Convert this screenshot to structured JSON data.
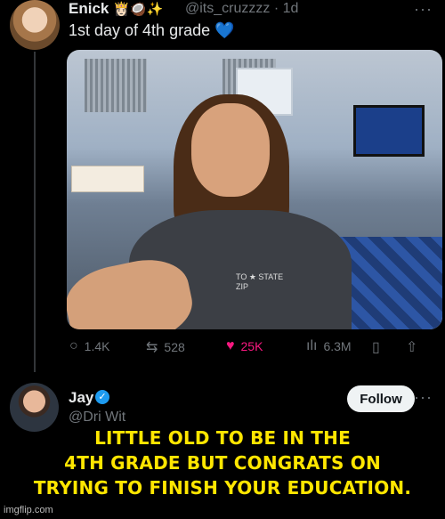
{
  "post": {
    "author_name": "Enick",
    "author_emojis": "👸🏻🥥✨",
    "handle": "@its_cruzzzz",
    "sep": "·",
    "time": "1d",
    "text": "1st day of 4th grade 💙",
    "menu": "···"
  },
  "media": {
    "shirt_text": "TO ★ STATE ZIP"
  },
  "actions": {
    "replies": "1.4K",
    "reposts": "528",
    "likes": "25K",
    "views": "6.3M",
    "icons": {
      "reply": "speech-bubble-icon",
      "repost": "repost-icon",
      "like": "heart-icon",
      "views": "bar-chart-icon",
      "bookmark": "bookmark-icon",
      "share": "share-icon"
    },
    "glyphs": {
      "reply": "○",
      "repost": "⇆",
      "like": "♥",
      "views": "ılı",
      "bookmark": "▯",
      "share": "⇧"
    }
  },
  "reply": {
    "name": "Jay",
    "handle": "@Dri Wit",
    "follow_label": "Follow",
    "menu": "···",
    "verified_glyph": "✓"
  },
  "meme_caption": "LITTLE OLD TO BE IN THE\n4TH GRADE BUT CONGRATS ON\nTRYING TO  FINISH YOUR EDUCATION.",
  "watermark": "imgflip.com",
  "colors": {
    "accent": "#1d9bf0",
    "like": "#f91880",
    "caption": "#ffe600"
  }
}
